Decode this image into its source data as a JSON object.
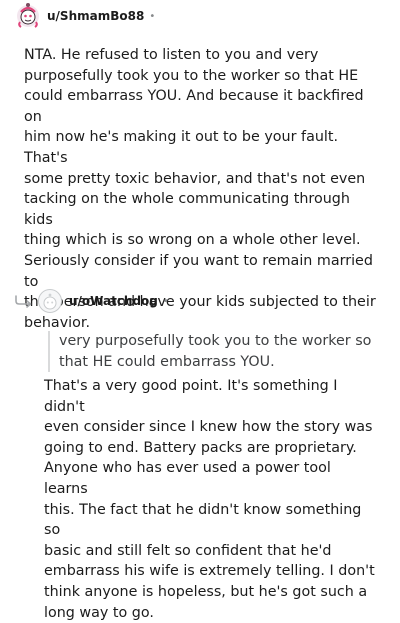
{
  "comments": [
    {
      "username": "u/ShmamBo88",
      "separator": "•",
      "avatar_icon": "snoo-avatar-pink",
      "body": "NTA. He refused to listen to you and very\npurposefully took you to the worker so that HE\ncould embarrass YOU. And because it backfired on\nhim now he's making it out to be your fault. That's\nsome pretty toxic behavior, and that's not even\ntacking on the whole communicating through kids\nthing which is so wrong on a whole other level.\nSeriously consider if you want to remain married to\nthis person and have your kids subjected to their\nbehavior."
    },
    {
      "username": "u/oWatchdog",
      "separator": "•",
      "avatar_icon": "default-avatar-icon",
      "reply_icon": "reply-arrow-icon",
      "quote": "very purposefully took you to the worker so\nthat HE could embarrass YOU.",
      "body": "That's a very good point. It's something I didn't\neven consider since I knew how the story was\ngoing to end. Battery packs are proprietary.\nAnyone who has ever used a power tool learns\nthis. The fact that he didn't know something so\nbasic and still felt so confident that he'd\nembarrass his wife is extremely telling. I don't\nthink anyone is hopeless, but he's got such a\nlong way to go."
    }
  ],
  "colors": {
    "text": "#1c1c1c",
    "meta": "#878a8c",
    "quote_bar": "#d9dadb",
    "avatar_accent": "#e0457b"
  }
}
